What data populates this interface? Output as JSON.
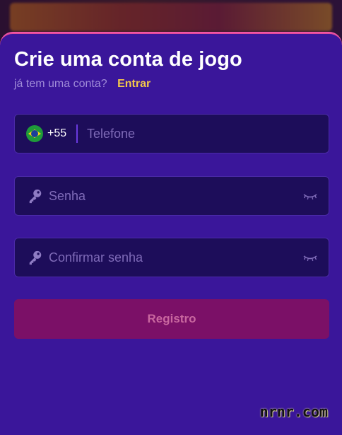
{
  "form": {
    "title": "Crie uma conta de jogo",
    "subtitle": "já tem uma conta?",
    "login_link": "Entrar",
    "phone": {
      "country_code": "+55",
      "flag_icon": "brazil-flag-icon",
      "placeholder": "Telefone",
      "value": ""
    },
    "password": {
      "placeholder": "Senha",
      "value": "",
      "icon": "key-icon",
      "toggle_icon": "eye-closed-icon"
    },
    "confirm_password": {
      "placeholder": "Confirmar senha",
      "value": "",
      "icon": "key-icon",
      "toggle_icon": "eye-closed-icon"
    },
    "submit_label": "Registro"
  },
  "watermark": "nrnr.com",
  "colors": {
    "sheet": "#3a169a",
    "field": "#1d0d5a",
    "accent_link": "#f4c94a",
    "button": "#7b1067",
    "border_top": "#e14c9b"
  }
}
